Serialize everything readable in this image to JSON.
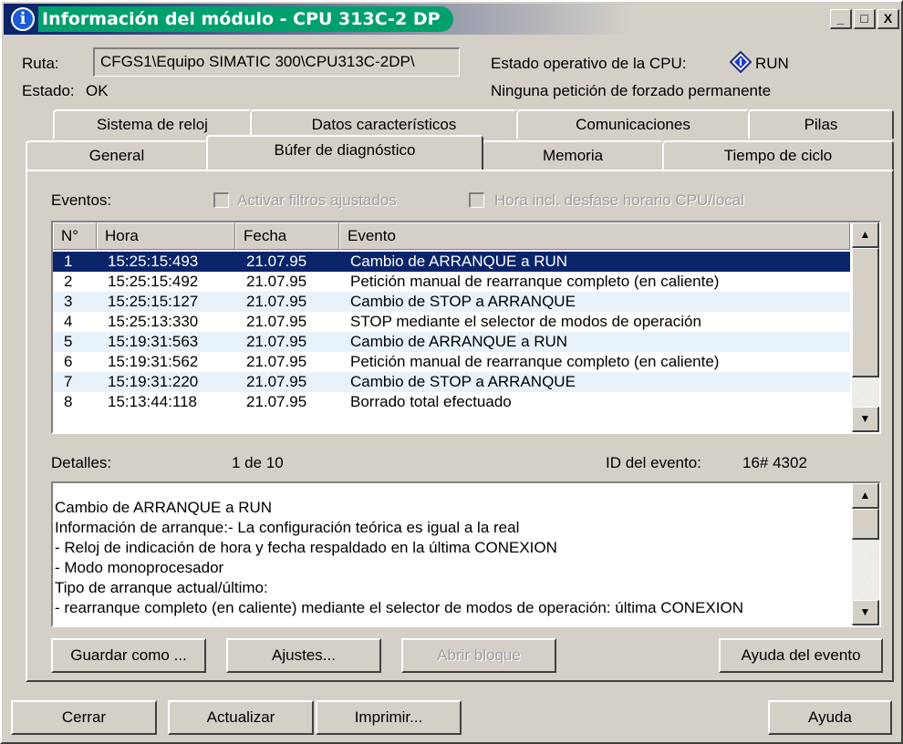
{
  "window": {
    "title": "Información del módulo - CPU 313C-2 DP",
    "minimize": "_",
    "maximize": "□",
    "close": "X"
  },
  "header": {
    "path_label": "Ruta:",
    "path_value": "CFGS1\\Equipo SIMATIC 300\\CPU313C-2DP\\",
    "status_label": "Estado:",
    "status_value": "OK",
    "cpu_state_label": "Estado operativo de la CPU:",
    "cpu_state_value": "RUN",
    "forcing_text": "Ninguna petición de forzado permanente"
  },
  "tabs": {
    "row1": [
      "Sistema de reloj",
      "Datos característicos",
      "Comunicaciones",
      "Pilas"
    ],
    "row2": [
      "General",
      "Búfer de diagnóstico",
      "Memoria",
      "Tiempo de ciclo"
    ],
    "active": "Búfer de diagnóstico"
  },
  "events": {
    "label": "Eventos:",
    "filter_checkbox": "Activar filtros ajustados",
    "filter_checked": false,
    "time_checkbox": "Hora incl. desfase horario CPU/local",
    "time_checked": false,
    "columns": [
      "N°",
      "Hora",
      "Fecha",
      "Evento"
    ],
    "rows": [
      {
        "n": "1",
        "hora": "15:25:15:493",
        "fecha": "21.07.95",
        "evento": "Cambio de ARRANQUE a RUN"
      },
      {
        "n": "2",
        "hora": "15:25:15:492",
        "fecha": "21.07.95",
        "evento": "Petición manual de rearranque completo (en caliente)"
      },
      {
        "n": "3",
        "hora": "15:25:15:127",
        "fecha": "21.07.95",
        "evento": "Cambio de STOP a ARRANQUE"
      },
      {
        "n": "4",
        "hora": "15:25:13:330",
        "fecha": "21.07.95",
        "evento": "STOP mediante el selector de modos de operación"
      },
      {
        "n": "5",
        "hora": "15:19:31:563",
        "fecha": "21.07.95",
        "evento": "Cambio de ARRANQUE a RUN"
      },
      {
        "n": "6",
        "hora": "15:19:31:562",
        "fecha": "21.07.95",
        "evento": "Petición manual de rearranque completo (en caliente)"
      },
      {
        "n": "7",
        "hora": "15:19:31:220",
        "fecha": "21.07.95",
        "evento": "Cambio de STOP a ARRANQUE"
      },
      {
        "n": "8",
        "hora": "15:13:44:118",
        "fecha": "21.07.95",
        "evento": "Borrado total efectuado"
      }
    ],
    "selected_row": 1
  },
  "details": {
    "label": "Detalles:",
    "count": "1 de 10",
    "event_id_label": "ID del evento:",
    "event_id_value": "16# 4302",
    "lines": [
      "Cambio de ARRANQUE a RUN",
      "Información de arranque:- La configuración teórica es igual a la real",
      "- Reloj de indicación de hora y fecha respaldado en la última CONEXION",
      "- Modo monoprocesador",
      "Tipo de arranque actual/último:",
      "- rearranque completo (en caliente) mediante el selector de modos de operación: última CONEXION"
    ]
  },
  "panel_buttons": {
    "save_as": "Guardar como ...",
    "settings": "Ajustes...",
    "open_block": "Abrir bloque",
    "event_help": "Ayuda del evento"
  },
  "bottom_buttons": {
    "close": "Cerrar",
    "refresh": "Actualizar",
    "print": "Imprimir...",
    "help": "Ayuda"
  },
  "colors": {
    "face": "#d4d0c8",
    "selection": "#0a246a",
    "title_highlight": "#00a06e",
    "alt_row": "#e8f2fb"
  }
}
